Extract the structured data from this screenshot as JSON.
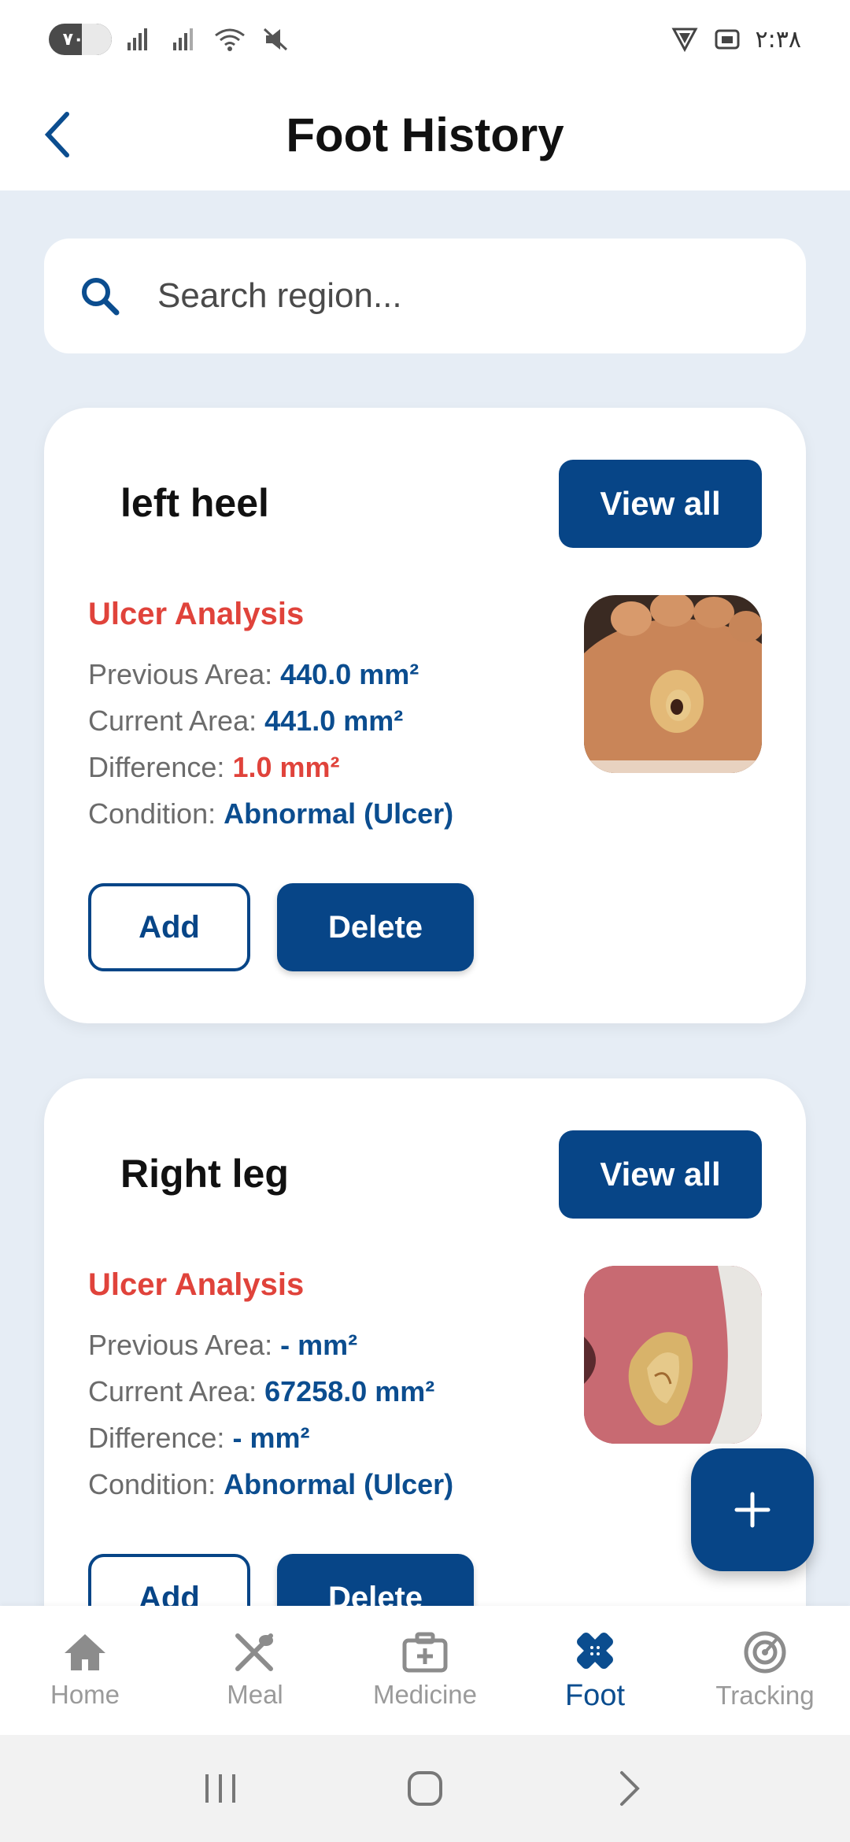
{
  "status_bar": {
    "battery": "۷۰",
    "time": "۲:۳۸"
  },
  "header": {
    "title": "Foot History"
  },
  "search": {
    "placeholder": "Search region..."
  },
  "cards": [
    {
      "region": "left heel",
      "view_all_label": "View all",
      "analysis_title": "Ulcer Analysis",
      "previous_area_label": "Previous Area:",
      "previous_area_value": "440.0 mm²",
      "current_area_label": "Current Area:",
      "current_area_value": "441.0 mm²",
      "difference_label": "Difference:",
      "difference_value": "1.0 mm²",
      "condition_label": "Condition:",
      "condition_value": "Abnormal (Ulcer)",
      "add_label": "Add",
      "delete_label": "Delete"
    },
    {
      "region": "Right leg",
      "view_all_label": "View all",
      "analysis_title": "Ulcer Analysis",
      "previous_area_label": "Previous Area:",
      "previous_area_value": "- mm²",
      "current_area_label": "Current Area:",
      "current_area_value": "67258.0 mm²",
      "difference_label": "Difference:",
      "difference_value": "- mm²",
      "condition_label": "Condition:",
      "condition_value": "Abnormal (Ulcer)",
      "add_label": "Add",
      "delete_label": "Delete"
    }
  ],
  "bottom_nav": {
    "items": [
      {
        "label": "Home",
        "icon": "home-icon"
      },
      {
        "label": "Meal",
        "icon": "utensils-icon"
      },
      {
        "label": "Medicine",
        "icon": "medkit-icon"
      },
      {
        "label": "Foot",
        "icon": "bandage-icon",
        "active": true
      },
      {
        "label": "Tracking",
        "icon": "tracking-icon"
      }
    ]
  },
  "colors": {
    "primary": "#074587",
    "accent_red": "#e0433b",
    "background": "#e6edf5"
  }
}
